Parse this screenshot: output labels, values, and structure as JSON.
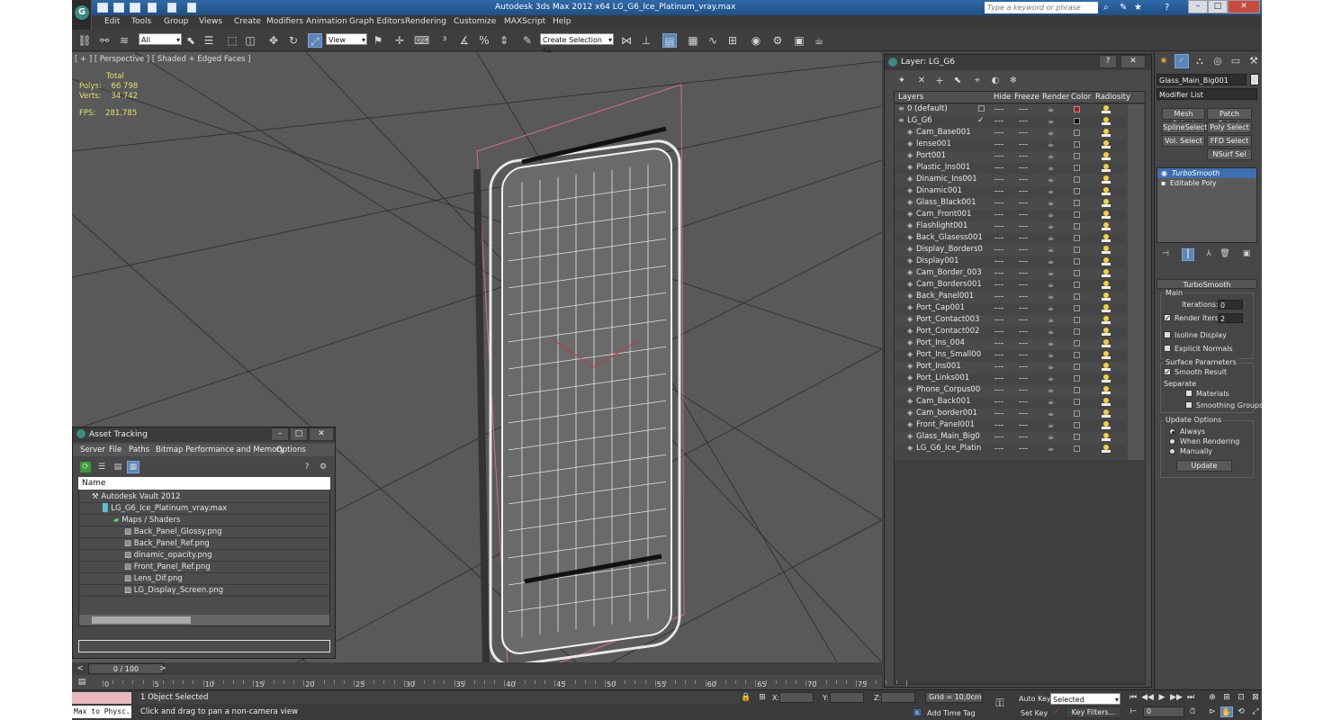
{
  "app": {
    "title": "Autodesk 3ds Max  2012 x64     LG_G6_Ice_Platinum_vray.max",
    "search_placeholder": "Type a keyword or phrase"
  },
  "menu": [
    "Edit",
    "Tools",
    "Group",
    "Views",
    "Create",
    "Modifiers",
    "Animation",
    "Graph Editors",
    "Rendering",
    "Customize",
    "MAXScript",
    "Help"
  ],
  "toolbar": {
    "filter_dropdown": "All",
    "refcoord_dropdown": "View",
    "selection_set": "Create Selection Se"
  },
  "viewport": {
    "label": "[ + ] [ Perspective ] [ Shaded + Edged Faces ]",
    "stats": {
      "total_label": "Total",
      "polys_label": "Polys:",
      "polys_value": "66 798",
      "verts_label": "Verts:",
      "verts_value": "34 742",
      "fps_label": "FPS:",
      "fps_value": "281,785"
    }
  },
  "asset_tracking": {
    "title": "Asset Tracking",
    "menu": [
      "Server",
      "File",
      "Paths",
      "Bitmap Performance and Memory",
      "Options"
    ],
    "name_header": "Name",
    "tree": [
      {
        "label": "Autodesk Vault 2012",
        "level": 0
      },
      {
        "label": "LG_G6_Ice_Platinum_vray.max",
        "level": 1
      },
      {
        "label": "Maps / Shaders",
        "level": 2
      },
      {
        "label": "Back_Panel_Glossy.png",
        "level": 3
      },
      {
        "label": "Back_Panel_Ref.png",
        "level": 3
      },
      {
        "label": "dinamic_opacity.png",
        "level": 3
      },
      {
        "label": "Front_Panel_Ref.png",
        "level": 3
      },
      {
        "label": "Lens_Dif.png",
        "level": 3
      },
      {
        "label": "LG_Display_Screen.png",
        "level": 3
      }
    ]
  },
  "layers": {
    "title": "Layer: LG_G6",
    "columns": [
      "Layers",
      "Hide",
      "Freeze",
      "Render",
      "Color",
      "Radiosity"
    ],
    "rows": [
      {
        "name": "0 (default)",
        "level": 0,
        "color": "#b11818"
      },
      {
        "name": "LG_G6",
        "level": 0,
        "color": "#111111",
        "current": true
      },
      {
        "name": "Cam_Base001",
        "level": 1
      },
      {
        "name": "lense001",
        "level": 1
      },
      {
        "name": "Port001",
        "level": 1
      },
      {
        "name": "Plastic_Ins001",
        "level": 1
      },
      {
        "name": "Dinamic_Ins001",
        "level": 1
      },
      {
        "name": "Dinamic001",
        "level": 1
      },
      {
        "name": "Glass_Black001",
        "level": 1
      },
      {
        "name": "Cam_Front001",
        "level": 1
      },
      {
        "name": "Flashlight001",
        "level": 1
      },
      {
        "name": "Back_Glasess001",
        "level": 1
      },
      {
        "name": "Display_Borders0",
        "level": 1
      },
      {
        "name": "Display001",
        "level": 1
      },
      {
        "name": "Cam_Border_003",
        "level": 1
      },
      {
        "name": "Cam_Borders001",
        "level": 1
      },
      {
        "name": "Back_Panel001",
        "level": 1
      },
      {
        "name": "Port_Cap001",
        "level": 1
      },
      {
        "name": "Port_Contact003",
        "level": 1
      },
      {
        "name": "Port_Contact002",
        "level": 1
      },
      {
        "name": "Port_Ins_004",
        "level": 1
      },
      {
        "name": "Port_Ins_Small00",
        "level": 1
      },
      {
        "name": "Port_Ins001",
        "level": 1
      },
      {
        "name": "Port_Links001",
        "level": 1
      },
      {
        "name": "Phone_Corpus00",
        "level": 1
      },
      {
        "name": "Cam_Back001",
        "level": 1
      },
      {
        "name": "Cam_border001",
        "level": 1
      },
      {
        "name": "Front_Panel001",
        "level": 1
      },
      {
        "name": "Glass_Main_Big0",
        "level": 1
      },
      {
        "name": "LG_G6_Ice_Platin",
        "level": 1
      }
    ]
  },
  "command_panel": {
    "object_name": "Glass_Main_Big001",
    "modifier_list": "Modifier List",
    "buttons": [
      "Mesh Select",
      "Patch Select",
      "SplineSelect",
      "Poly Select",
      "Vol. Select",
      "FFD Select",
      "NSurf Sel"
    ],
    "stack": [
      {
        "label": "TurboSmooth",
        "selected": true
      },
      {
        "label": "Editable Poly",
        "selected": false
      }
    ],
    "rollout_title": "TurboSmooth",
    "main_label": "Main",
    "iterations_label": "Iterations:",
    "iterations_value": "0",
    "render_iters_label": "Render Iters:",
    "render_iters_value": "2",
    "isoline": "Isoline Display",
    "explicit_normals": "Explicit Normals",
    "surface_params": "Surface Parameters",
    "smooth_result": "Smooth Result",
    "separate": "Separate",
    "materials": "Materials",
    "smoothing_groups": "Smoothing Groups",
    "update_options": "Update Options",
    "always": "Always",
    "when_rendering": "When Rendering",
    "manually": "Manually",
    "update_button": "Update"
  },
  "timeline": {
    "frame_display": "0 / 100",
    "ticks": [
      "0",
      "5",
      "10",
      "15",
      "20",
      "25",
      "30",
      "35",
      "40",
      "45",
      "50",
      "55",
      "60",
      "65",
      "70",
      "75"
    ]
  },
  "status": {
    "maxscript": "Max to Physc.",
    "selected": "1 Object Selected",
    "prompt": "Click and drag to pan a non-camera view",
    "x_label": "X:",
    "y_label": "Y:",
    "z_label": "Z:",
    "grid": "Grid = 10,0cm",
    "add_time_tag": "Add Time Tag",
    "auto_key": "Auto Key",
    "set_key": "Set Key",
    "key_mode": "Selected",
    "key_filters": "Key Filters...",
    "frame_value": "0"
  }
}
